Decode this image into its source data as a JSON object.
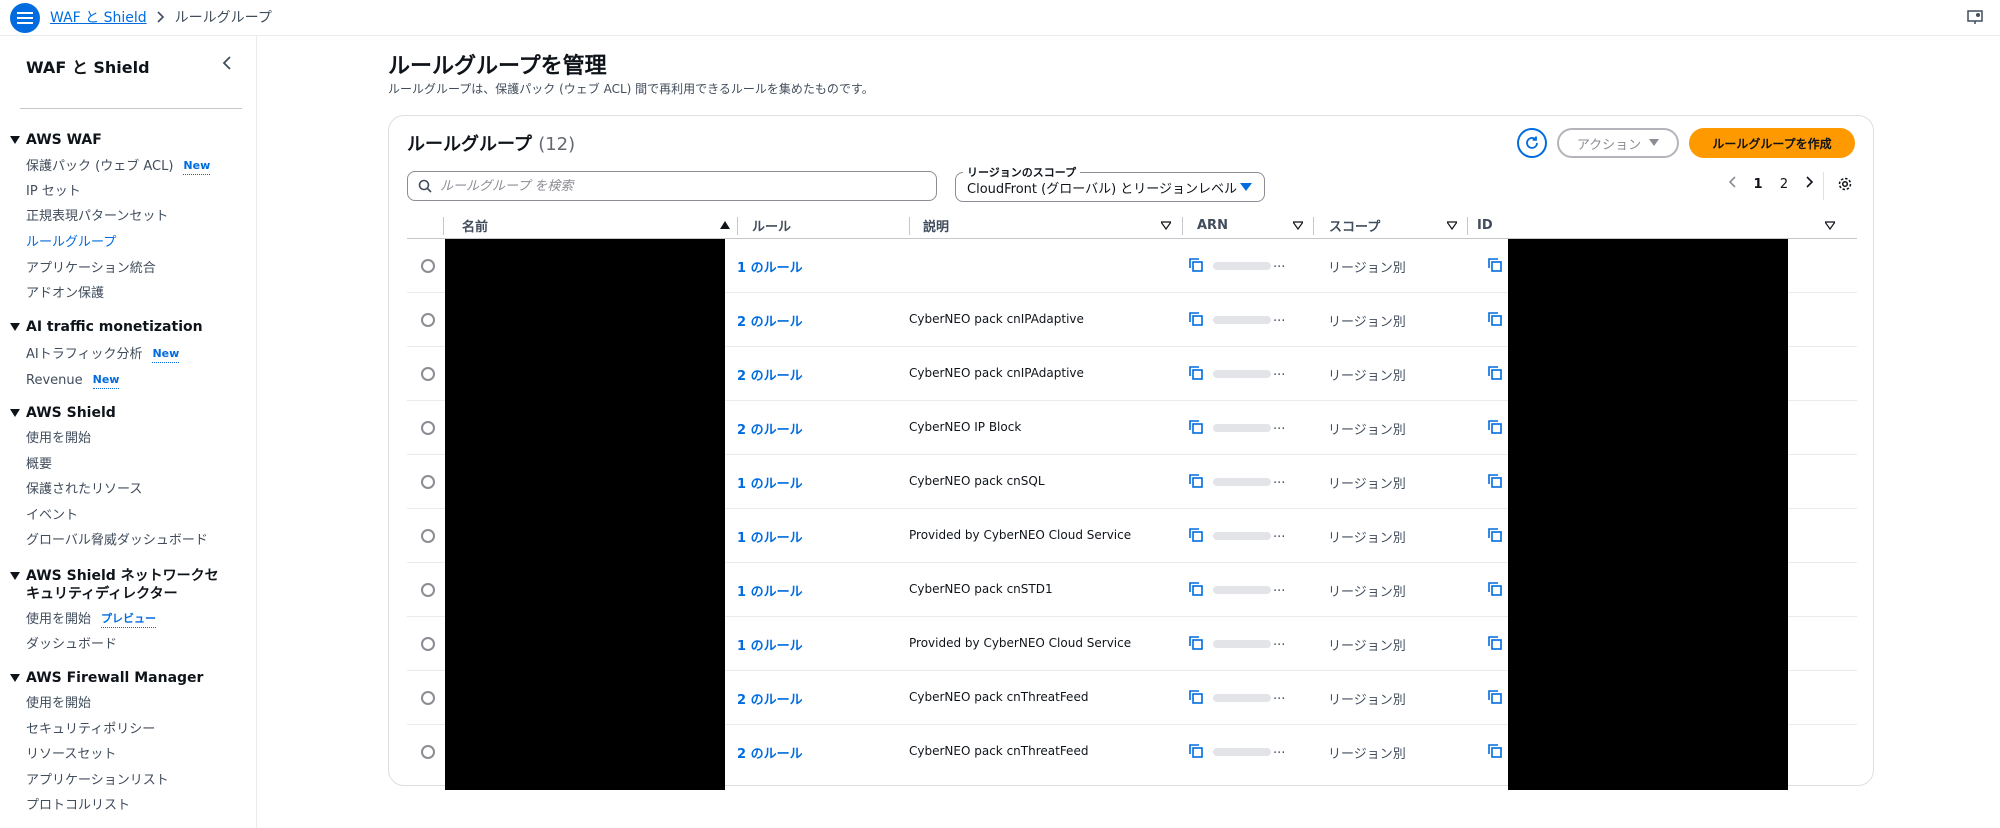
{
  "breadcrumb": {
    "root": "WAF と Shield",
    "current": "ルールグループ"
  },
  "sidebar": {
    "title": "WAF と Shield",
    "sections": [
      {
        "title": "AWS WAF",
        "items": [
          {
            "label": "保護パック (ウェブ ACL)",
            "badge": "New"
          },
          {
            "label": "IP セット"
          },
          {
            "label": "正規表現パターンセット"
          },
          {
            "label": "ルールグループ",
            "active": true
          },
          {
            "label": "アプリケーション統合"
          },
          {
            "label": "アドオン保護"
          }
        ]
      },
      {
        "title": "AI traffic monetization",
        "items": [
          {
            "label": "AIトラフィック分析",
            "badge": "New"
          },
          {
            "label": "Revenue",
            "badge": "New"
          }
        ]
      },
      {
        "title": "AWS Shield",
        "items": [
          {
            "label": "使用を開始"
          },
          {
            "label": "概要"
          },
          {
            "label": "保護されたリソース"
          },
          {
            "label": "イベント"
          },
          {
            "label": "グローバル脅威ダッシュボード"
          }
        ]
      },
      {
        "title": "AWS Shield ネットワークセキュリティディレクター",
        "items": [
          {
            "label": "使用を開始",
            "badge": "プレビュー"
          },
          {
            "label": "ダッシュボード"
          }
        ]
      },
      {
        "title": "AWS Firewall Manager",
        "items": [
          {
            "label": "使用を開始"
          },
          {
            "label": "セキュリティポリシー"
          },
          {
            "label": "リソースセット"
          },
          {
            "label": "アプリケーションリスト"
          },
          {
            "label": "プロトコルリスト"
          }
        ]
      }
    ]
  },
  "page": {
    "title": "ルールグループを管理",
    "description": "ルールグループは、保護パック (ウェブ ACL) 間で再利用できるルールを集めたものです。"
  },
  "table": {
    "heading": "ルールグループ",
    "count": "(12)",
    "actions_label": "アクション",
    "create_label": "ルールグループを作成",
    "search_placeholder": "ルールグループ を検索",
    "scope_label": "リージョンのスコープ",
    "scope_value": "CloudFront (グローバル) とリージョンレベル",
    "pages": [
      "1",
      "2"
    ],
    "current_page": "1",
    "columns": {
      "name": "名前",
      "rules": "ルール",
      "description": "説明",
      "arn": "ARN",
      "scope": "スコープ",
      "id": "ID"
    },
    "rows": [
      {
        "rules": "1 のルール",
        "description": "",
        "arn_suffix": "...",
        "scope": "リージョン別"
      },
      {
        "rules": "2 のルール",
        "description": "CyberNEO pack cnIPAdaptive",
        "arn_suffix": "...",
        "scope": "リージョン別"
      },
      {
        "rules": "2 のルール",
        "description": "CyberNEO pack cnIPAdaptive",
        "arn_suffix": "...",
        "scope": "リージョン別"
      },
      {
        "rules": "2 のルール",
        "description": "CyberNEO IP Block",
        "arn_suffix": "...",
        "scope": "リージョン別"
      },
      {
        "rules": "1 のルール",
        "description": "CyberNEO pack cnSQL",
        "arn_suffix": "...",
        "scope": "リージョン別"
      },
      {
        "rules": "1 のルール",
        "description": "Provided by CyberNEO Cloud Service",
        "arn_suffix": "...",
        "scope": "リージョン別"
      },
      {
        "rules": "1 のルール",
        "description": "CyberNEO pack cnSTD1",
        "arn_suffix": "...",
        "scope": "リージョン別"
      },
      {
        "rules": "1 のルール",
        "description": "Provided by CyberNEO Cloud Service",
        "arn_suffix": "...",
        "scope": "リージョン別"
      },
      {
        "rules": "2 のルール",
        "description": "CyberNEO pack cnThreatFeed",
        "arn_suffix": "...",
        "scope": "リージョン別"
      },
      {
        "rules": "2 のルール",
        "description": "CyberNEO pack cnThreatFeed",
        "arn_suffix": "...",
        "scope": "リージョン別"
      }
    ]
  },
  "colors": {
    "accent": "#006ce0",
    "primary_button": "#ff9900",
    "text": "#0f141a"
  }
}
